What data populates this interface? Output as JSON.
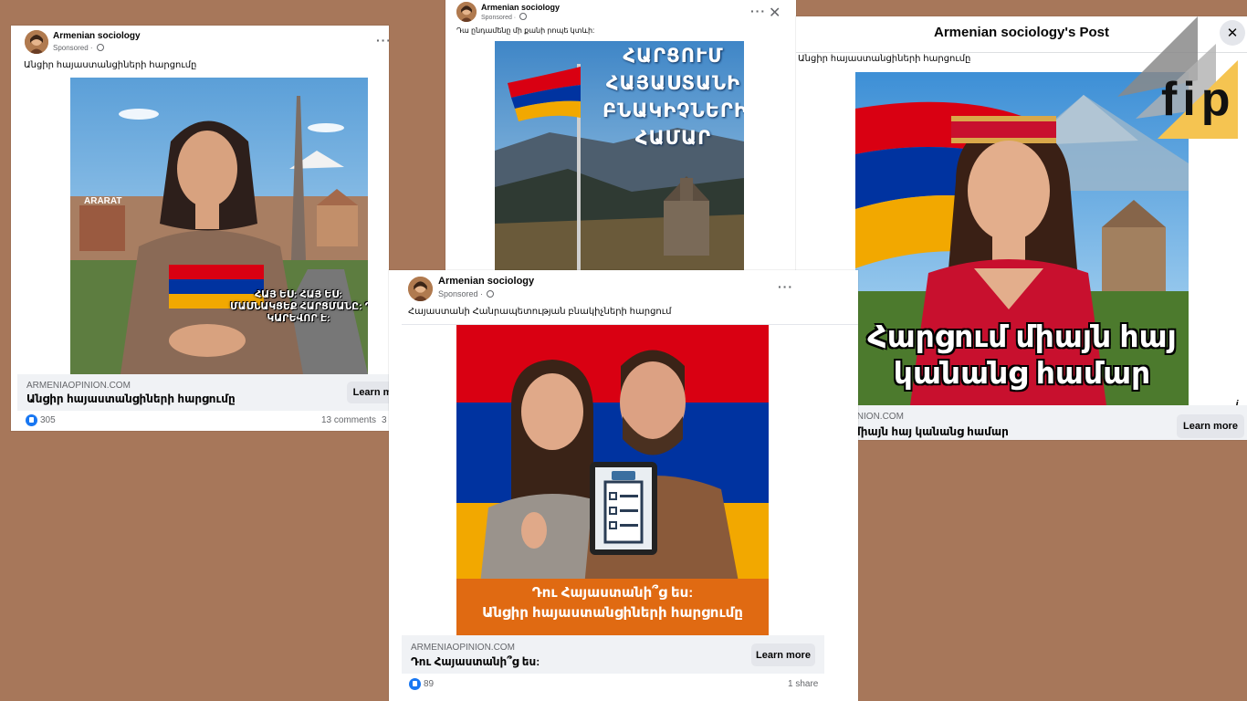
{
  "colors": {
    "background": "#a7775a",
    "facebook_blue": "#1877f2",
    "flag_red": "#d90012",
    "flag_blue": "#0033a0",
    "flag_orange": "#f2a800",
    "logo_yellow": "#f5c451",
    "logo_gray": "#8a8a8a"
  },
  "icons": [
    "avatar",
    "globe-icon",
    "more-options-icon",
    "close-icon",
    "like-icon",
    "info-icon",
    "clipboard-checklist-icon",
    "fip-logo"
  ],
  "ad1": {
    "page_name": "Armenian sociology",
    "sponsored": "Sponsored ·",
    "text": "Անցիր հայաստանցիների հարցումը",
    "image_caption_line1": "ՀԱՅ ԵՍ: ՀԱՅ ԵՍ:",
    "image_caption_line2": "ՄԱՍՆԱԿՑԵՔ ՀԱՐՑՄԱՆԸ: ԴԱ",
    "image_caption_line3": "ԿԱՐԵՎՈՐ Է:",
    "image_sign": "ARARAT",
    "domain": "ARMENIAOPINION.COM",
    "link_title": "Անցիր հայաստանցիների հարցումը",
    "learn_more": "Learn m",
    "likes": "305",
    "comments": "13 comments",
    "shares": "3"
  },
  "ad2": {
    "page_name": "Armenian sociology",
    "sponsored": "Sponsored ·",
    "text": "Դա ընդամենը մի քանի րոպե կտևի:",
    "image_line1": "ՀԱՐՑՈՒՄ",
    "image_line2": "ՀԱՅԱՍՏԱՆԻ",
    "image_line3": "ԲՆԱԿԻՉՆԵՐԻ",
    "image_line4": "ՀԱՄԱՐ"
  },
  "ad3": {
    "page_name": "Armenian sociology",
    "sponsored": "Sponsored ·",
    "text": "Հայաստանի Հանրապետության բնակիչների հարցում",
    "image_line1": "Դու Հայաստանի՞ց ես:",
    "image_line2": "Անցիր հայաստանցիների հարցումը",
    "domain": "ARMENIAOPINION.COM",
    "link_title": "Դու Հայաստանի՞ց ես:",
    "learn_more": "Learn more",
    "likes": "89",
    "shares": "1 share"
  },
  "ad4": {
    "header_title": "Armenian sociology's Post",
    "text": "Անցիր հայաստանցիների հարցումը",
    "image_line1": "Հարցում միայն հայ",
    "image_line2": "կանանց համար",
    "domain": "ARMENIAOPINION.COM",
    "link_title": "Հարցում միայն հայ կանանց համար",
    "learn_more": "Learn more",
    "info": "i"
  },
  "watermark": {
    "text": "fip"
  }
}
